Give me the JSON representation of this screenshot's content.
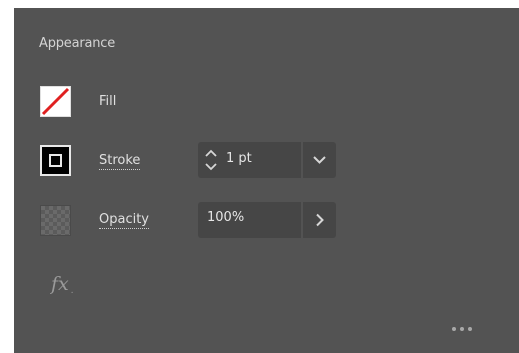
{
  "panel": {
    "title": "Appearance"
  },
  "fill": {
    "label": "Fill"
  },
  "stroke": {
    "label": "Stroke",
    "weight_value": "1 pt"
  },
  "opacity": {
    "label": "Opacity",
    "value": "100%"
  },
  "icons": {
    "fill": "fill-none-swatch-icon",
    "stroke": "stroke-swatch-icon",
    "opacity": "opacity-checkerboard-icon",
    "stepper": "up-down-stepper-icon",
    "dropdown": "chevron-down-icon",
    "opacity_flyout": "chevron-right-icon",
    "effects": "fx-icon",
    "more": "more-options-icon"
  },
  "colors": {
    "panel_background": "#535353",
    "field_background": "#464646",
    "none_slash": "#e02020"
  }
}
